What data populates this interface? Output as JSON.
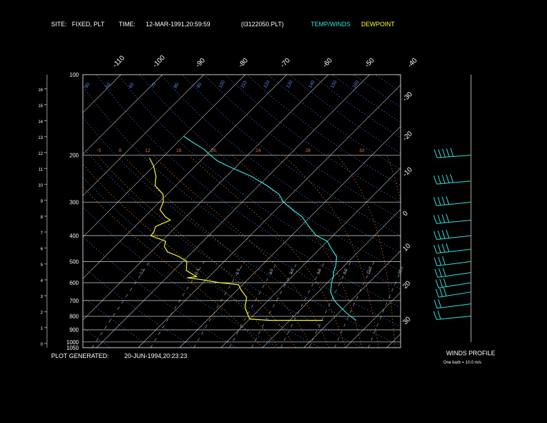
{
  "header": {
    "site_label": "SITE:",
    "site_value": "FIXED, PLT",
    "time_label": "TIME:",
    "time_value": "12-MAR-1991,20:59:59",
    "file_name": "(I3122050.PLT)",
    "legend_temp": "TEMP/WINDS",
    "legend_dew": "DEWPOINT",
    "legend_temp_color": "#33e6e6",
    "legend_dew_color": "#ffff33"
  },
  "footer": {
    "generated_label": "PLOT GENERATED:",
    "generated_value": "20-JUN-1994,20:23:23",
    "winds_title": "WINDS PROFILE",
    "barb_note": "One barb = 10.0 m/s"
  },
  "chart_data": {
    "type": "line",
    "subtype": "skew-t sounding",
    "pressure_levels": [
      "100",
      "200",
      "300",
      "400",
      "500",
      "600",
      "700",
      "800",
      "900",
      "1000",
      "1050"
    ],
    "height_km_ticks": [
      "0",
      "1",
      "2",
      "3",
      "4",
      "5",
      "6",
      "7",
      "8",
      "9",
      "10",
      "11",
      "12",
      "13",
      "14",
      "15",
      "16"
    ],
    "skewed_temp_ticks_top": [
      "-110",
      "-100",
      "-90",
      "-80",
      "-70",
      "-60",
      "-50",
      "-40"
    ],
    "skewed_temp_ticks_right": [
      "-30",
      "-20",
      "-10",
      "0",
      "10",
      "20",
      "30"
    ],
    "mixing_ratio_labels": [
      "0.1",
      "0.4",
      "1.0",
      "2.0",
      "3.0",
      "5.0",
      "8.0",
      "12.0",
      "20.0"
    ],
    "dry_adiabat_labels": [
      "-5",
      "8",
      "12",
      "16",
      "20",
      "24",
      "28",
      "32"
    ],
    "saturated_adiabat_labels": [
      "90",
      "50",
      "60",
      "70",
      "80",
      "90",
      "100",
      "110",
      "120",
      "130",
      "140",
      "150",
      "160"
    ],
    "series": [
      {
        "name": "TEMP/WINDS",
        "color": "#33e6e6",
        "points": [
          [
            830,
            16
          ],
          [
            780,
            12
          ],
          [
            740,
            9
          ],
          [
            700,
            6
          ],
          [
            650,
            3
          ],
          [
            600,
            1
          ],
          [
            570,
            0
          ],
          [
            550,
            -1
          ],
          [
            520,
            -2
          ],
          [
            480,
            -4
          ],
          [
            450,
            -7
          ],
          [
            420,
            -10
          ],
          [
            400,
            -14
          ],
          [
            370,
            -18
          ],
          [
            340,
            -22
          ],
          [
            320,
            -26
          ],
          [
            300,
            -30
          ],
          [
            280,
            -33
          ],
          [
            260,
            -38
          ],
          [
            240,
            -44
          ],
          [
            220,
            -52
          ],
          [
            210,
            -56
          ],
          [
            200,
            -59
          ],
          [
            190,
            -62
          ],
          [
            180,
            -66
          ],
          [
            170,
            -70
          ]
        ]
      },
      {
        "name": "DEWPOINT",
        "color": "#ffff33",
        "points": [
          [
            830,
            8
          ],
          [
            830,
            -5
          ],
          [
            820,
            -10
          ],
          [
            780,
            -12
          ],
          [
            740,
            -14
          ],
          [
            680,
            -16
          ],
          [
            640,
            -19
          ],
          [
            610,
            -21
          ],
          [
            600,
            -26
          ],
          [
            585,
            -31
          ],
          [
            575,
            -35
          ],
          [
            570,
            -33
          ],
          [
            540,
            -37
          ],
          [
            500,
            -39
          ],
          [
            480,
            -42
          ],
          [
            460,
            -46
          ],
          [
            440,
            -48
          ],
          [
            420,
            -49
          ],
          [
            400,
            -54
          ],
          [
            390,
            -54
          ],
          [
            370,
            -55
          ],
          [
            350,
            -53
          ],
          [
            340,
            -55
          ],
          [
            320,
            -58
          ],
          [
            300,
            -59
          ],
          [
            280,
            -61
          ],
          [
            260,
            -65
          ],
          [
            240,
            -67
          ],
          [
            220,
            -70
          ],
          [
            205,
            -73
          ]
        ]
      }
    ],
    "winds_profile": [
      {
        "p": 800,
        "dir": 270,
        "spd": 18
      },
      {
        "p": 720,
        "dir": 260,
        "spd": 22
      },
      {
        "p": 650,
        "dir": 250,
        "spd": 25
      },
      {
        "p": 600,
        "dir": 250,
        "spd": 28
      },
      {
        "p": 550,
        "dir": 255,
        "spd": 30
      },
      {
        "p": 500,
        "dir": 260,
        "spd": 32
      },
      {
        "p": 450,
        "dir": 265,
        "spd": 35
      },
      {
        "p": 400,
        "dir": 265,
        "spd": 38
      },
      {
        "p": 350,
        "dir": 270,
        "spd": 40
      },
      {
        "p": 300,
        "dir": 270,
        "spd": 42
      },
      {
        "p": 250,
        "dir": 275,
        "spd": 45
      },
      {
        "p": 200,
        "dir": 280,
        "spd": 48
      }
    ]
  }
}
